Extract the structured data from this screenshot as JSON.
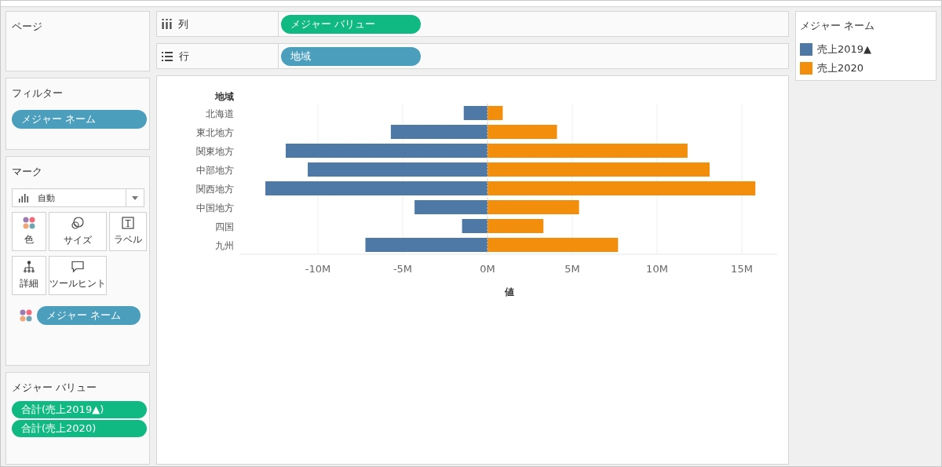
{
  "pages_shelf": {
    "title": "ページ"
  },
  "columns_shelf": {
    "label": "列",
    "pill": {
      "text": "メジャー バリュー",
      "kind": "measure"
    }
  },
  "rows_shelf": {
    "label": "行",
    "pill": {
      "text": "地域",
      "kind": "dimension"
    }
  },
  "filters": {
    "title": "フィルター",
    "pills": [
      {
        "text": "メジャー ネーム",
        "kind": "dimension"
      }
    ]
  },
  "marks": {
    "title": "マーク",
    "mark_type": "自動",
    "buttons": [
      {
        "label": "色",
        "kind": "color"
      },
      {
        "label": "サイズ",
        "kind": "size"
      },
      {
        "label": "ラベル",
        "kind": "label"
      },
      {
        "label": "詳細",
        "kind": "detail"
      },
      {
        "label": "ツールヒント",
        "kind": "tooltip"
      }
    ],
    "pills": [
      {
        "text": "メジャー ネーム",
        "kind": "dimension"
      }
    ]
  },
  "measure_values": {
    "title": "メジャー バリュー",
    "pills": [
      {
        "text": "合計(売上2019▲)",
        "kind": "measure"
      },
      {
        "text": "合計(売上2020)",
        "kind": "measure"
      }
    ]
  },
  "chart": {
    "row_header": "地域",
    "chart_data": {
      "type": "bar",
      "orientation": "horizontal",
      "stacked": true,
      "grid": true,
      "xlabel": "値",
      "categories": [
        "北海道",
        "東北地方",
        "関東地方",
        "中部地方",
        "関西地方",
        "中国地方",
        "四国",
        "九州"
      ],
      "series": [
        {
          "name": "売上2019▲",
          "color": "#4e79a7",
          "values": [
            -1.4,
            -5.7,
            -11.9,
            -10.6,
            -13.1,
            -4.3,
            -1.5,
            -7.2
          ]
        },
        {
          "name": "売上2020",
          "color": "#f28e0b",
          "values": [
            0.9,
            4.1,
            11.8,
            13.1,
            15.8,
            5.4,
            3.3,
            7.7
          ]
        }
      ],
      "ref_lines": [
        {
          "axis": "x",
          "value": 0
        }
      ],
      "xlim": [
        -14.6,
        17.1
      ],
      "xticks": [
        {
          "value": -10,
          "label": "-10M"
        },
        {
          "value": -5,
          "label": "-5M"
        },
        {
          "value": 0,
          "label": "0M"
        },
        {
          "value": 5,
          "label": "5M"
        },
        {
          "value": 10,
          "label": "10M"
        },
        {
          "value": 15,
          "label": "15M"
        }
      ]
    }
  },
  "legend": {
    "title": "メジャー ネーム"
  }
}
